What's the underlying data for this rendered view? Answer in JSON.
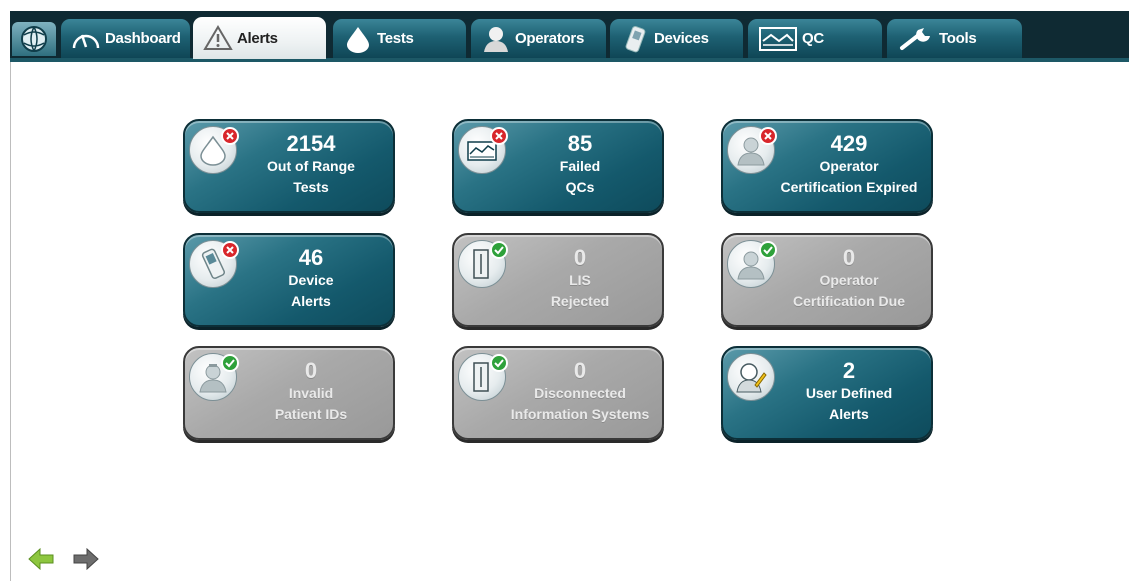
{
  "tabs": [
    {
      "id": "dashboard",
      "label": "Dashboard",
      "icon": "gauge-icon",
      "active": false
    },
    {
      "id": "alerts",
      "label": "Alerts",
      "icon": "warning-icon",
      "active": true
    },
    {
      "id": "tests",
      "label": "Tests",
      "icon": "drop-icon",
      "active": false
    },
    {
      "id": "operators",
      "label": "Operators",
      "icon": "operator-icon",
      "active": false
    },
    {
      "id": "devices",
      "label": "Devices",
      "icon": "device-icon",
      "active": false
    },
    {
      "id": "qc",
      "label": "QC",
      "icon": "qc-chart-icon",
      "active": false
    },
    {
      "id": "tools",
      "label": "Tools",
      "icon": "wrench-icon",
      "active": false
    }
  ],
  "tiles": [
    {
      "count": "2154",
      "line1": "Out of Range",
      "line2": "Tests",
      "state": "on",
      "icon": "drop-icon",
      "badge": "err"
    },
    {
      "count": "85",
      "line1": "Failed",
      "line2": "QCs",
      "state": "on",
      "icon": "qc-chart-icon",
      "badge": "err"
    },
    {
      "count": "429",
      "line1": "Operator",
      "line2": "Certification Expired",
      "state": "on",
      "icon": "operator-icon",
      "badge": "err"
    },
    {
      "count": "46",
      "line1": "Device",
      "line2": "Alerts",
      "state": "on",
      "icon": "device-icon",
      "badge": "err"
    },
    {
      "count": "0",
      "line1": "LIS",
      "line2": "Rejected",
      "state": "off",
      "icon": "server-icon",
      "badge": "ok"
    },
    {
      "count": "0",
      "line1": "Operator",
      "line2": "Certification Due",
      "state": "off",
      "icon": "operator-icon",
      "badge": "ok"
    },
    {
      "count": "0",
      "line1": "Invalid",
      "line2": "Patient IDs",
      "state": "off",
      "icon": "patient-icon",
      "badge": "ok"
    },
    {
      "count": "0",
      "line1": "Disconnected",
      "line2": "Information Systems",
      "state": "off",
      "icon": "server-icon",
      "badge": "ok"
    },
    {
      "count": "2",
      "line1": "User Defined",
      "line2": "Alerts",
      "state": "on",
      "icon": "user-edit-icon",
      "badge": "pen"
    }
  ],
  "nav": {
    "back": "back-arrow-icon",
    "forward": "forward-arrow-icon"
  },
  "colors": {
    "tile_active": "#14596c",
    "tile_inactive": "#a9a9a9",
    "error": "#d8262b",
    "ok": "#2ea13a",
    "bar": "#0f2a33"
  }
}
